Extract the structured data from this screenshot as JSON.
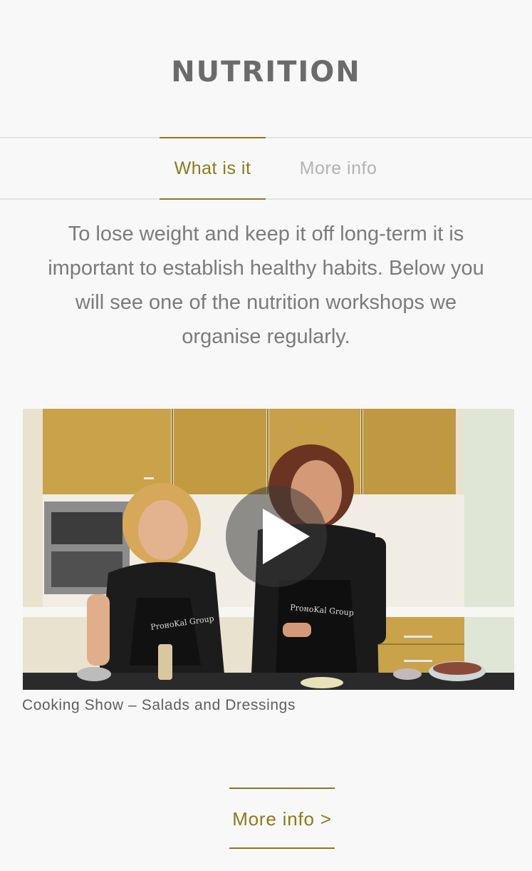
{
  "header": {
    "title": "NUTRITION"
  },
  "tabs": [
    {
      "label": "What is it",
      "active": true
    },
    {
      "label": "More info",
      "active": false
    }
  ],
  "intro": {
    "text": "To lose weight and keep it off long-term it is important to establish healthy habits. Below you will see one of the nutrition workshops we organise regularly."
  },
  "video": {
    "caption": "Cooking Show – Salads and Dressings",
    "apron_brand": "ProноKal Group"
  },
  "footer": {
    "more_info_label": "More info >"
  },
  "colors": {
    "accent": "#8a7a1e",
    "background": "#f8f8f8",
    "text": "#7b7b7b",
    "divider": "#e4e4e4"
  }
}
